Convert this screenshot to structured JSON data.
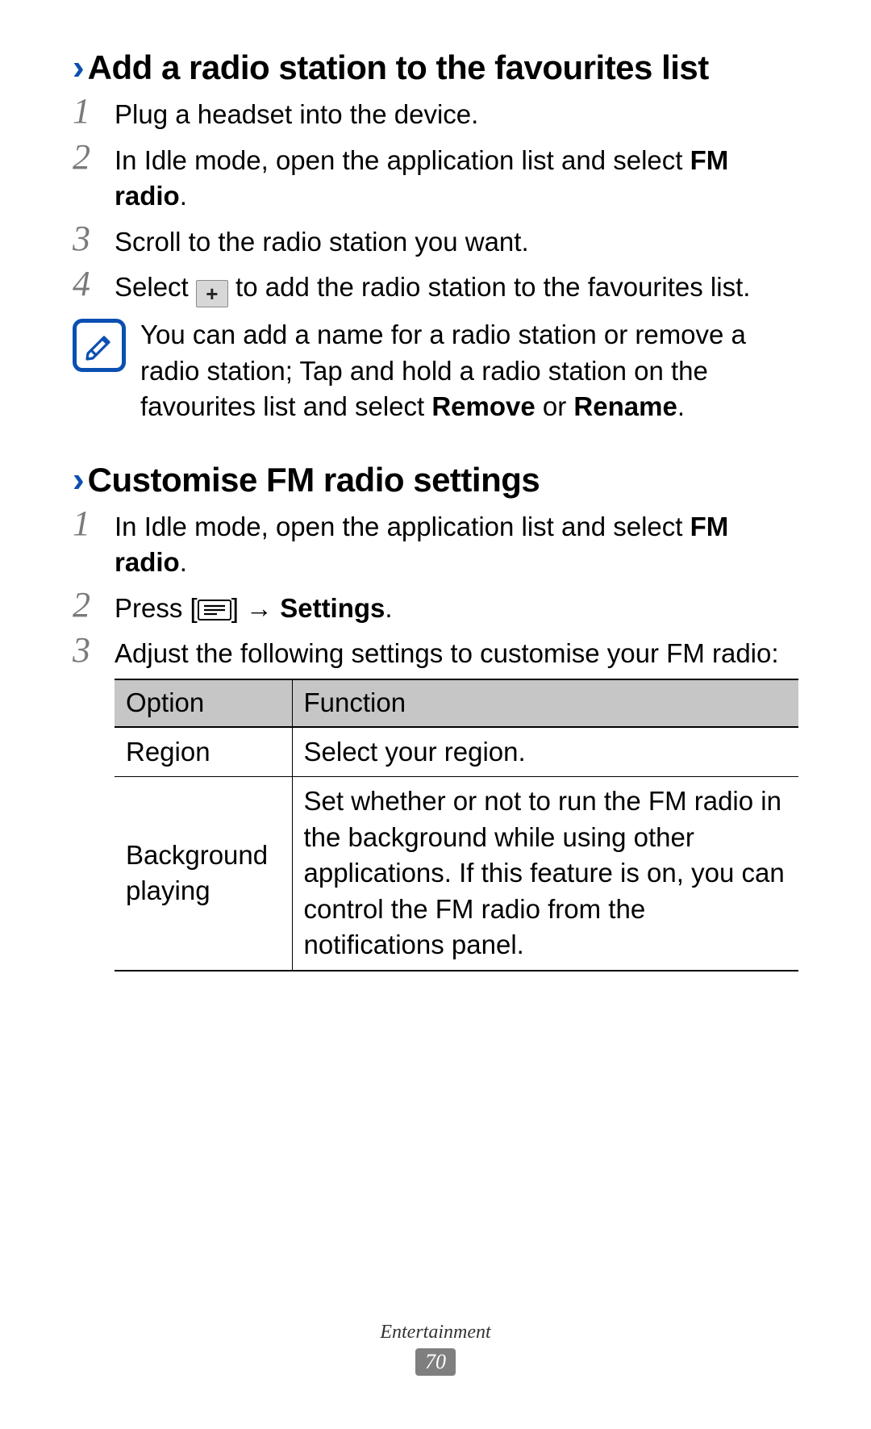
{
  "section1": {
    "title": "Add a radio station to the favourites list",
    "steps": {
      "s1": "Plug a headset into the device.",
      "s2_pre": "In Idle mode, open the application list and select ",
      "s2_bold1": "FM radio",
      "s2_post": ".",
      "s3": "Scroll to the radio station you want.",
      "s4_pre": "Select ",
      "s4_post": " to add the radio station to the favourites list."
    },
    "note_pre": "You can add a name for a radio station or remove a radio station; Tap and hold a radio station on the favourites list and select ",
    "note_b1": "Remove",
    "note_mid": " or ",
    "note_b2": "Rename",
    "note_post": "."
  },
  "section2": {
    "title": "Customise FM radio settings",
    "steps": {
      "s1_pre": "In Idle mode, open the application list and select ",
      "s1_bold1": "FM radio",
      "s1_post": ".",
      "s2_pre": "Press [",
      "s2_mid": "] → ",
      "s2_bold": "Settings",
      "s2_post": ".",
      "s3": "Adjust the following settings to customise your FM radio:"
    },
    "table": {
      "h1": "Option",
      "h2": "Function",
      "rows": [
        {
          "opt": "Region",
          "func": "Select your region."
        },
        {
          "opt": "Background playing",
          "func": "Set whether or not to run the FM radio in the background while using other applications. If this feature is on, you can control the FM radio from the notifications panel."
        }
      ]
    }
  },
  "footer": {
    "category": "Entertainment",
    "page": "70"
  },
  "nums": {
    "n1": "1",
    "n2": "2",
    "n3": "3",
    "n4": "4"
  }
}
